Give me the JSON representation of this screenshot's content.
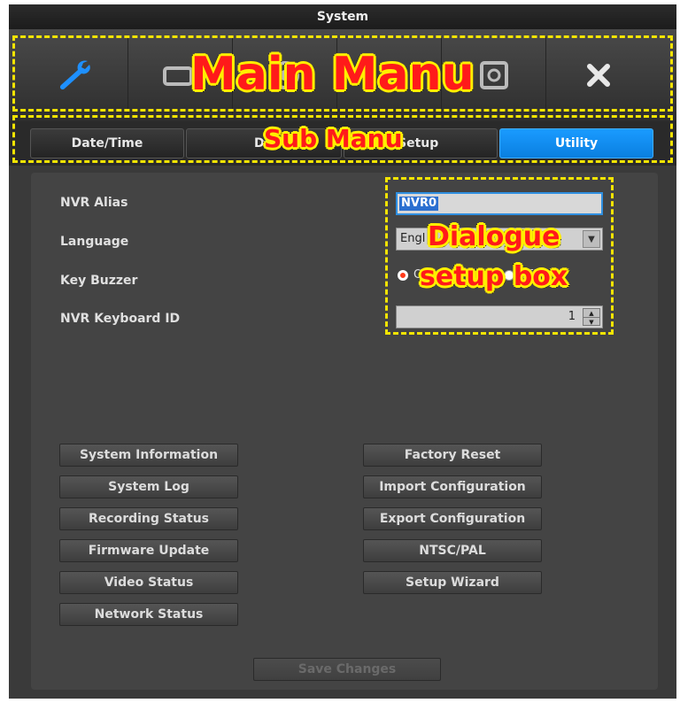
{
  "window": {
    "title": "System"
  },
  "main_menu": {
    "items": [
      {
        "icon": "wrench-icon",
        "color": "#1e90ff"
      },
      {
        "icon": "camera-icon"
      },
      {
        "icon": "record-icon"
      },
      {
        "icon": "network-icon"
      },
      {
        "icon": "storage-icon"
      },
      {
        "icon": "close-icon"
      }
    ]
  },
  "sub_menu": {
    "tabs": [
      {
        "label": "Date/Time",
        "active": false
      },
      {
        "label": "Di",
        "active": false
      },
      {
        "label": "Setup",
        "active": false
      },
      {
        "label": "Utility",
        "active": true
      }
    ],
    "active_color": "#1a9bff"
  },
  "settings": {
    "nvr_alias": {
      "label": "NVR Alias",
      "value": "NVR0"
    },
    "language": {
      "label": "Language",
      "value": "Engl"
    },
    "key_buzzer": {
      "label": "Key Buzzer",
      "on_label": "On",
      "off_label": "Off",
      "selected": "On"
    },
    "keyboard_id": {
      "label": "NVR Keyboard ID",
      "value": "1"
    }
  },
  "buttons": {
    "left": [
      "System Information",
      "System Log",
      "Recording Status",
      "Firmware Update",
      "Video Status",
      "Network Status"
    ],
    "right": [
      "Factory Reset",
      "Import Configuration",
      "Export Configuration",
      "NTSC/PAL",
      "Setup Wizard"
    ],
    "save": "Save Changes"
  },
  "annotations": {
    "main_menu": "Main Manu",
    "sub_menu": "Sub Manu",
    "dialogue": [
      "Dialogue",
      "setup box"
    ],
    "color": "#f4e400"
  }
}
